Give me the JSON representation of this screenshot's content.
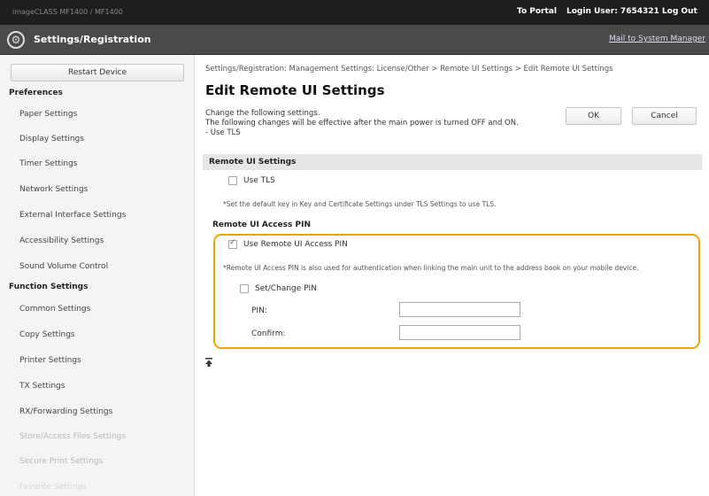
{
  "topbar": {
    "device_name": "imageCLASS MF1400 / MF1400",
    "to_portal": "To Portal",
    "login_user": "Login User: 7654321 Log Out"
  },
  "header": {
    "title": "Settings/Registration",
    "mail_link": "Mail to System Manager"
  },
  "sidebar": {
    "restart_button": "Restart Device",
    "preferences_heading": "Preferences",
    "preferences_items": [
      "Paper Settings",
      "Display Settings",
      "Timer Settings",
      "Network Settings",
      "External Interface Settings",
      "Accessibility Settings",
      "Sound Volume Control"
    ],
    "function_heading": "Function Settings",
    "function_items": [
      "Common Settings",
      "Copy Settings",
      "Printer Settings",
      "TX Settings",
      "RX/Forwarding Settings",
      "Store/Access Files Settings",
      "Secure Print Settings",
      "Favorite Settings"
    ]
  },
  "main": {
    "breadcrumb": "Settings/Registration: Management Settings: License/Other > Remote UI Settings > Edit Remote UI Settings",
    "title": "Edit Remote UI Settings",
    "desc_line1": "Change the following settings.",
    "desc_line2": "The following changes will be effective after the main power is turned OFF and ON.",
    "desc_line3": "- Use TLS",
    "ok_button": "OK",
    "cancel_button": "Cancel",
    "section_title": "Remote UI Settings",
    "use_tls_label": "Use TLS",
    "use_tls_checked": false,
    "tls_note": "*Set the default key in Key and Certificate Settings under TLS Settings to use TLS.",
    "access_pin_heading": "Remote UI Access PIN",
    "use_pin_label": "Use Remote UI Access PIN",
    "use_pin_checked": true,
    "pin_note": "*Remote UI Access PIN is also used for authentication when linking the main unit to the address book on your mobile device.",
    "set_change_pin_label": "Set/Change PIN",
    "set_change_pin_checked": false,
    "pin_label": "PIN:",
    "pin_value": "",
    "confirm_label": "Confirm:",
    "confirm_value": ""
  },
  "colors": {
    "highlight": "#f0a400",
    "topbar": "#1e1e1e",
    "header": "#4a4a4a"
  }
}
